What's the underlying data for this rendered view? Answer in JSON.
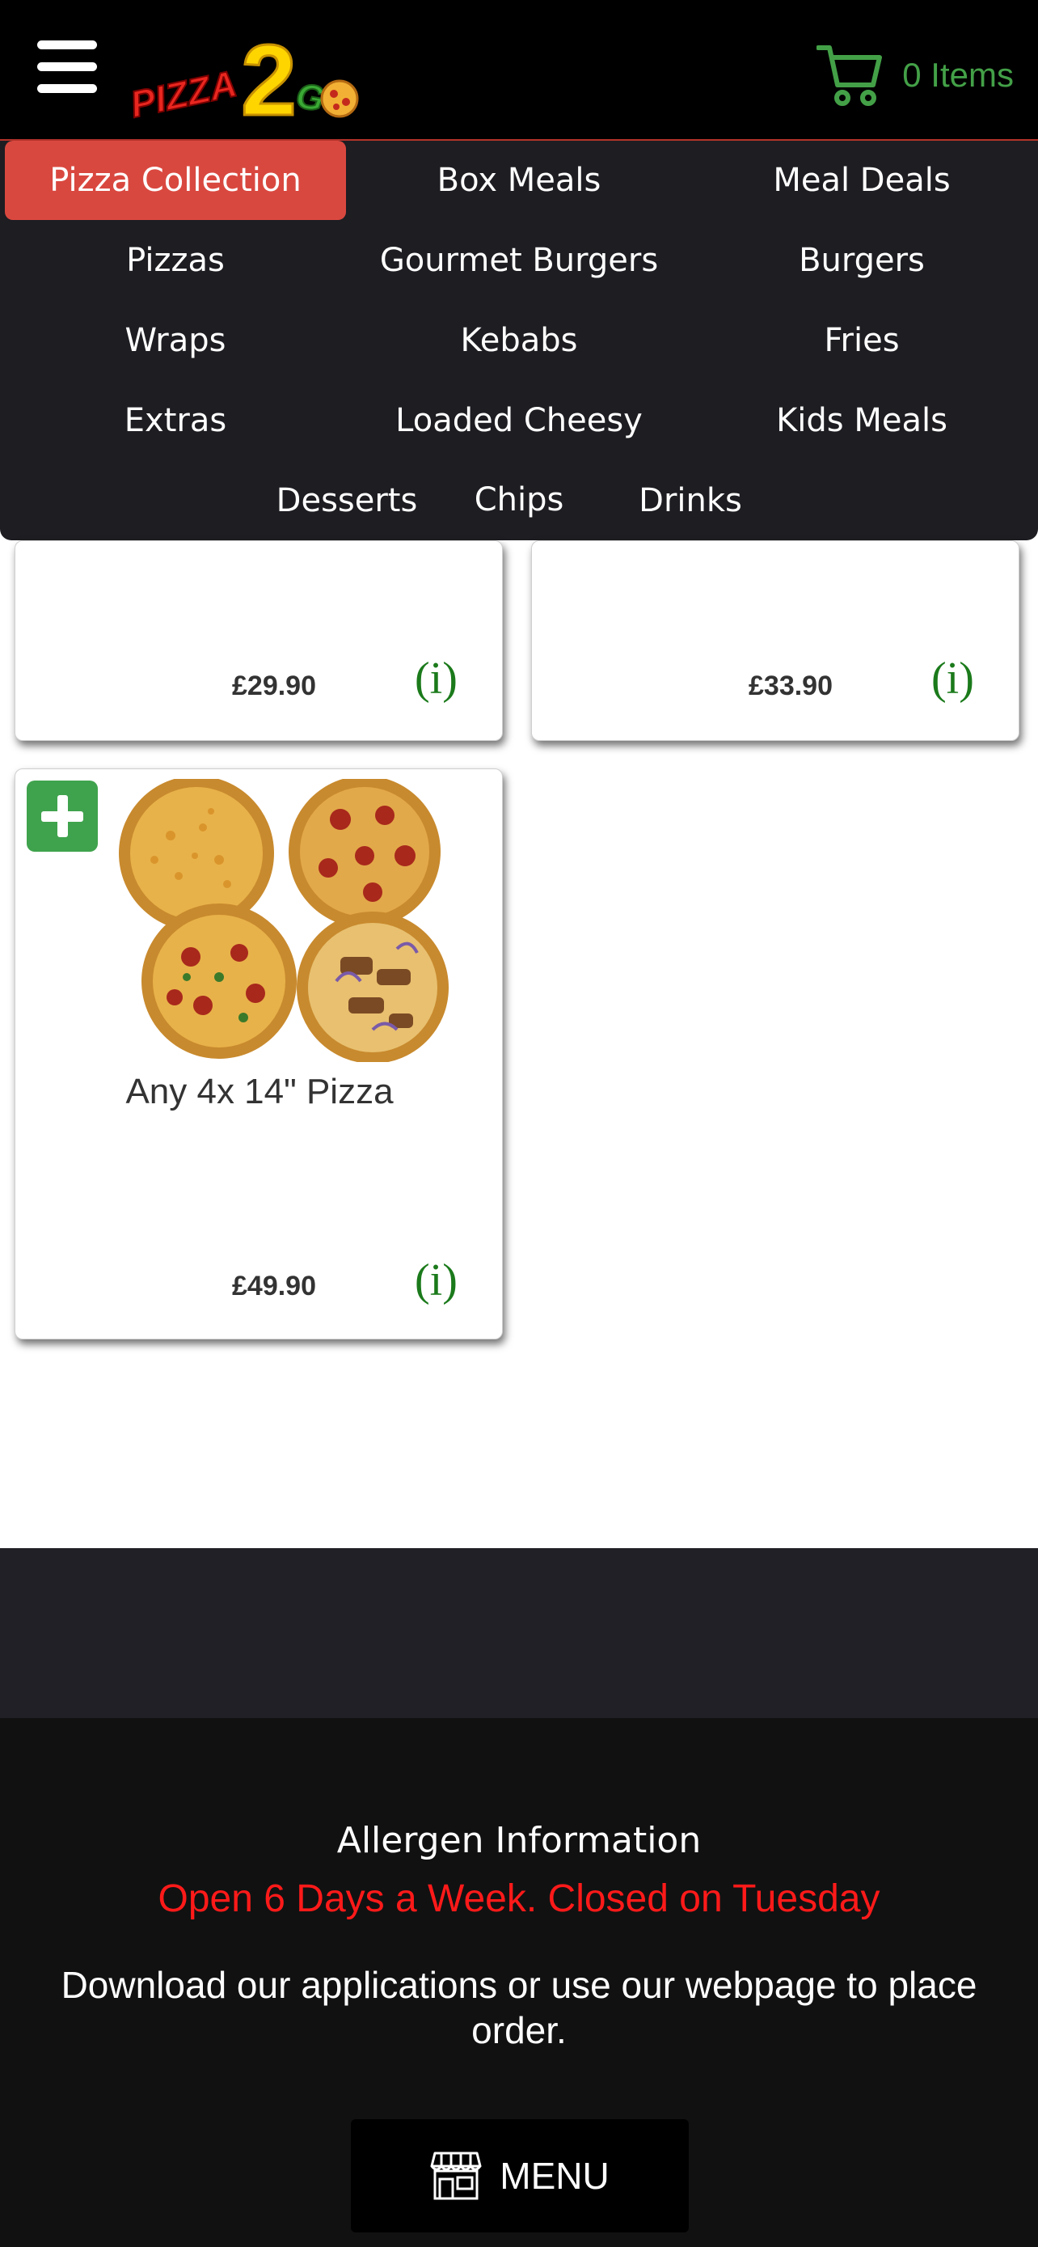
{
  "header": {
    "logo_text": "PIZZA 2 GO",
    "cart_label": "0 Items"
  },
  "categories": [
    {
      "label": "Pizza Collection",
      "active": true
    },
    {
      "label": "Box Meals"
    },
    {
      "label": "Meal Deals"
    },
    {
      "label": "Pizzas"
    },
    {
      "label": "Gourmet Burgers"
    },
    {
      "label": "Burgers"
    },
    {
      "label": "Wraps"
    },
    {
      "label": "Kebabs"
    },
    {
      "label": "Fries"
    },
    {
      "label": "Extras"
    },
    {
      "label": "Loaded Cheesy Chips"
    },
    {
      "label": "Kids Meals"
    },
    {
      "label": "Desserts"
    },
    {
      "label": "Drinks"
    }
  ],
  "products": [
    {
      "name": "",
      "price": "£29.90",
      "info": "(i)"
    },
    {
      "name": "",
      "price": "£33.90",
      "info": "(i)"
    },
    {
      "name": "Any 4x 14\" Pizza",
      "price": "£49.90",
      "info": "(i)"
    }
  ],
  "footer": {
    "allergen": "Allergen Information",
    "open_notice": "Open 6 Days a Week. Closed on Tuesday",
    "download": "Download our applications or use our webpage to place order.",
    "menu_button": "MENU"
  },
  "colors": {
    "accent_green": "#43a047",
    "active_red": "#d9483f",
    "notice_red": "#ff1a1a"
  },
  "icons": {
    "menu": "hamburger-icon",
    "cart": "cart-icon",
    "add": "plus-icon",
    "store": "store-icon"
  }
}
